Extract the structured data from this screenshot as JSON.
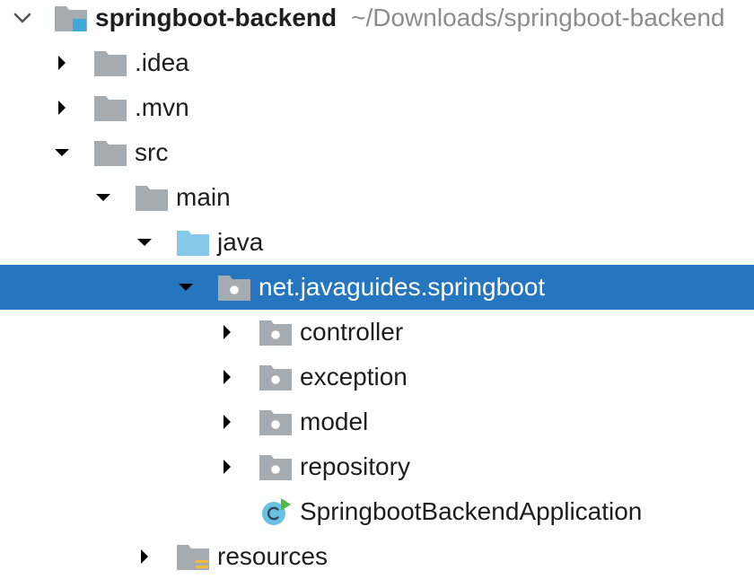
{
  "project": {
    "name": "springboot-backend",
    "path": "~/Downloads/springboot-backend"
  },
  "items": [
    {
      "label": ".idea"
    },
    {
      "label": ".mvn"
    },
    {
      "label": "src"
    },
    {
      "label": "main"
    },
    {
      "label": "java"
    },
    {
      "label": "net.javaguides.springboot"
    },
    {
      "label": "controller"
    },
    {
      "label": "exception"
    },
    {
      "label": "model"
    },
    {
      "label": "repository"
    },
    {
      "label": "SpringbootBackendApplication"
    },
    {
      "label": "resources"
    }
  ],
  "colors": {
    "selection": "#2675bf",
    "folder": "#a4acb1",
    "source_folder": "#86c9ea",
    "module_badge": "#3ea9dc",
    "class_circle": "#6cc1e3",
    "run_marker": "#4cbb3f",
    "resources_marker": "#f5b942"
  }
}
